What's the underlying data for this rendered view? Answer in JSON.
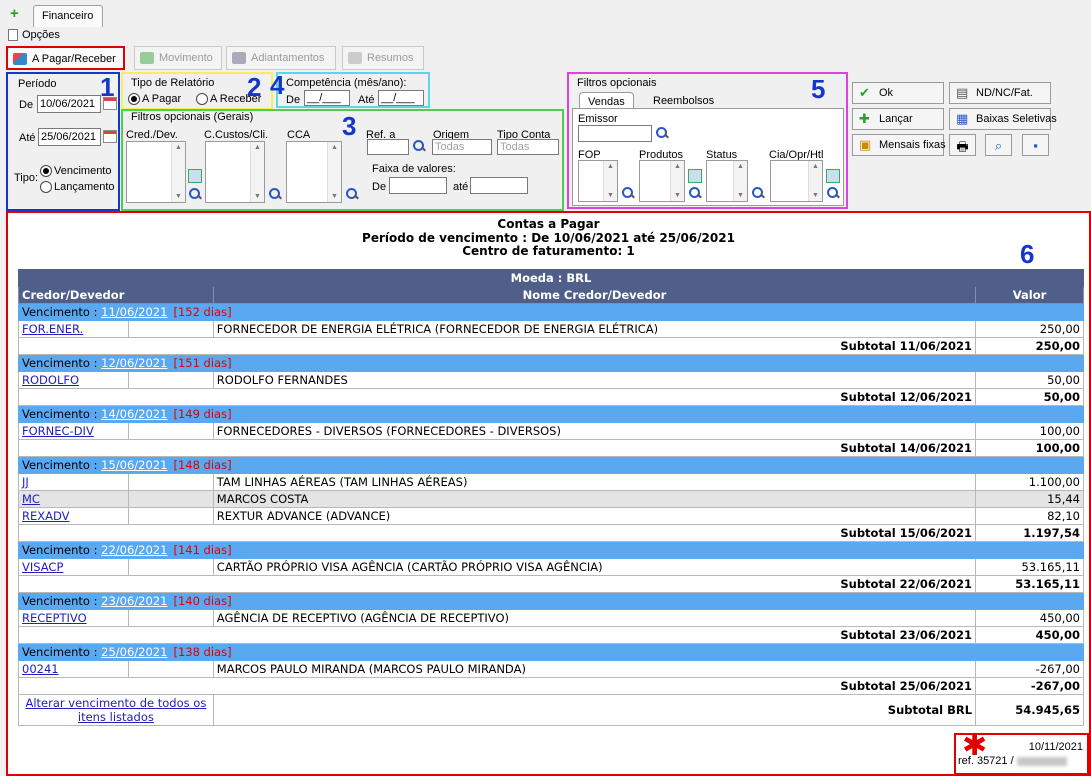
{
  "tabs": {
    "main": "Financeiro"
  },
  "menu": {
    "opcoes": "Opções"
  },
  "toolbar": [
    {
      "label": "A Pagar/Receber",
      "active": true
    },
    {
      "label": "Movimento",
      "active": false
    },
    {
      "label": "Adiantamentos",
      "active": false
    },
    {
      "label": "Resumos",
      "active": false
    }
  ],
  "annotations": {
    "n1": "1",
    "n2": "2",
    "n3": "3",
    "n4": "4",
    "n5": "5",
    "n6": "6"
  },
  "periodo": {
    "title": "Período",
    "de_label": "De",
    "de_value": "10/06/2021",
    "ate_label": "Até",
    "ate_value": "25/06/2021",
    "tipo_label": "Tipo:",
    "opt_vencimento": "Vencimento",
    "opt_lancamento": "Lançamento"
  },
  "tipo_relatorio": {
    "title": "Tipo de Relatório",
    "opt_pagar": "A Pagar",
    "opt_receber": "A Receber"
  },
  "competencia": {
    "title": "Competência (mês/ano):",
    "de_label": "De",
    "de_value": "__/___",
    "ate_label": "Até",
    "ate_value": "__/___"
  },
  "filtros_gerais": {
    "title": "Filtros opcionais (Gerais)",
    "cred_dev": "Cred./Dev.",
    "ccustos": "C.Custos/Cli.",
    "cca": "CCA",
    "ref_a": "Ref. a",
    "origem": "Origem",
    "origem_value": "Todas",
    "tipo_conta": "Tipo Conta",
    "tipo_conta_value": "Todas",
    "faixa": "Faixa de valores:",
    "faixa_de": "De",
    "faixa_ate": "até"
  },
  "filtros_opcionais": {
    "title": "Filtros opcionais",
    "tab_vendas": "Vendas",
    "tab_reembolsos": "Reembolsos",
    "emissor": "Emissor",
    "fop": "FOP",
    "produtos": "Produtos",
    "status": "Status",
    "cia": "Cia/Opr/Htl"
  },
  "actions": {
    "ok": "Ok",
    "nd": "ND/NC/Fat.",
    "lancar": "Lançar",
    "baixas": "Baixas Seletivas",
    "mensais": "Mensais fixas"
  },
  "report": {
    "title": "Contas a Pagar",
    "periodo": "Período de vencimento : De 10/06/2021 até 25/06/2021",
    "centro": "Centro de faturamento: 1",
    "moeda": "Moeda : BRL",
    "col_cred": "Credor/Devedor",
    "col_nome": "Nome Credor/Devedor",
    "col_valor": "Valor",
    "venc_label": "Vencimento :",
    "groups": [
      {
        "date": "11/06/2021",
        "dias": "[152 dias]",
        "rows": [
          {
            "code": "FOR.ENER.",
            "name": "FORNECEDOR DE ENERGIA ELÉTRICA (FORNECEDOR DE ENERGIA ELÉTRICA)",
            "value": "250,00"
          }
        ],
        "subtotal_label": "Subtotal 11/06/2021",
        "subtotal": "250,00"
      },
      {
        "date": "12/06/2021",
        "dias": "[151 dias]",
        "rows": [
          {
            "code": "RODOLFO",
            "name": "RODOLFO FERNANDES",
            "value": "50,00"
          }
        ],
        "subtotal_label": "Subtotal 12/06/2021",
        "subtotal": "50,00"
      },
      {
        "date": "14/06/2021",
        "dias": "[149 dias]",
        "rows": [
          {
            "code": "FORNEC-DIV",
            "name": "FORNECEDORES - DIVERSOS (FORNECEDORES - DIVERSOS)",
            "value": "100,00"
          }
        ],
        "subtotal_label": "Subtotal 14/06/2021",
        "subtotal": "100,00"
      },
      {
        "date": "15/06/2021",
        "dias": "[148 dias]",
        "rows": [
          {
            "code": "JJ",
            "name": "TAM LINHAS AÉREAS (TAM LINHAS AÉREAS)",
            "value": "1.100,00"
          },
          {
            "code": "MC",
            "name": "MARCOS COSTA",
            "value": "15,44"
          },
          {
            "code": "REXADV",
            "name": "REXTUR ADVANCE (ADVANCE)",
            "value": "82,10"
          }
        ],
        "subtotal_label": "Subtotal 15/06/2021",
        "subtotal": "1.197,54"
      },
      {
        "date": "22/06/2021",
        "dias": "[141 dias]",
        "rows": [
          {
            "code": "VISACP",
            "name": "CARTÃO PRÓPRIO VISA AGÊNCIA (CARTÃO PRÓPRIO VISA AGÊNCIA)",
            "value": "53.165,11"
          }
        ],
        "subtotal_label": "Subtotal 22/06/2021",
        "subtotal": "53.165,11"
      },
      {
        "date": "23/06/2021",
        "dias": "[140 dias]",
        "rows": [
          {
            "code": "RECEPTIVO",
            "name": "AGÊNCIA DE RECEPTIVO (AGÊNCIA DE RECEPTIVO)",
            "value": "450,00"
          }
        ],
        "subtotal_label": "Subtotal 23/06/2021",
        "subtotal": "450,00"
      },
      {
        "date": "25/06/2021",
        "dias": "[138 dias]",
        "rows": [
          {
            "code": "00241",
            "name": "MARCOS PAULO MIRANDA (MARCOS PAULO MIRANDA)",
            "value": "-267,00"
          }
        ],
        "subtotal_label": "Subtotal 25/06/2021",
        "subtotal": "-267,00"
      }
    ],
    "alterar_link": "Alterar vencimento de todos os itens listados",
    "total_label": "Subtotal BRL",
    "total": "54.945,65"
  },
  "footer": {
    "date": "10/11/2021",
    "ref": "ref. 35721 /"
  },
  "colors": {
    "accent_red": "#e00000",
    "header_blue": "#4f5f8a",
    "venc_blue": "#5aa8f0",
    "link": "#2020c0"
  }
}
